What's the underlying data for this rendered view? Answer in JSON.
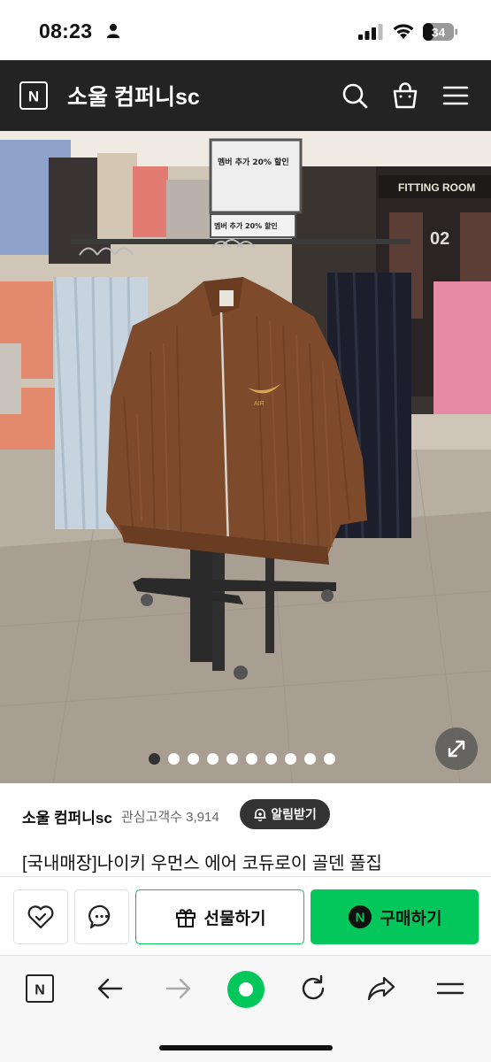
{
  "status_bar": {
    "time": "08:23",
    "battery": "34"
  },
  "header": {
    "title": "소울 컴퍼니sc",
    "logo_letter": "N"
  },
  "gallery": {
    "total_images": 10,
    "active_index": 0
  },
  "photo_signs": {
    "fitting_room": "FITTING ROOM",
    "sign_top": "멤버 추가 20% 할인",
    "sign_bottom": "멤버 추가 20% 할인"
  },
  "seller": {
    "name": "소울 컴퍼니sc",
    "followers_label": "관심고객수 3,914",
    "alarm_button": "알림받기"
  },
  "product": {
    "title": "[국내매장]나이키 우먼스 에어 코듀로이 골덴 풀집"
  },
  "actions": {
    "gift_label": "선물하기",
    "buy_label": "구매하기",
    "buy_badge": "N"
  },
  "colors": {
    "accent": "#03c75a",
    "header_bg": "#232323"
  },
  "browser_bar": {
    "logo_letter": "N"
  }
}
